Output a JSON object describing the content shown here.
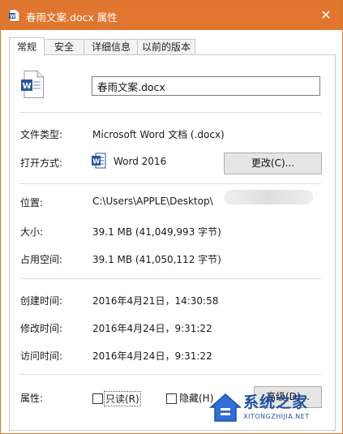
{
  "window": {
    "title": "春雨文案.docx 属性",
    "close_glyph": "✕",
    "accent_color": "#e0762f"
  },
  "tabs": [
    {
      "label": "常规",
      "active": true
    },
    {
      "label": "安全",
      "active": false
    },
    {
      "label": "详细信息",
      "active": false
    },
    {
      "label": "以前的版本",
      "active": false
    }
  ],
  "general": {
    "file_icon": "word-document-icon",
    "filename": "春雨文案.docx",
    "type_label": "文件类型:",
    "type_value": "Microsoft Word 文档 (.docx)",
    "opens_with_label": "打开方式:",
    "opens_with_icon": "word-icon",
    "opens_with_value": "Word 2016",
    "change_button": "更改(C)...",
    "location_label": "位置:",
    "location_value": "C:\\Users\\APPLE\\Desktop\\",
    "size_label": "大小:",
    "size_value": "39.1 MB (41,049,993 字节)",
    "size_on_disk_label": "占用空间:",
    "size_on_disk_value": "39.1 MB (41,050,112 字节)",
    "created_label": "创建时间:",
    "created_value": "2016年4月21日，14:30:58",
    "modified_label": "修改时间:",
    "modified_value": "2016年4月24日，9:31:22",
    "accessed_label": "访问时间:",
    "accessed_value": "2016年4月24日，9:31:22",
    "attributes_label": "属性:",
    "readonly_label": "只读(R)",
    "readonly_checked": false,
    "hidden_label": "隐藏(H)",
    "hidden_checked": false,
    "advanced_button": "高级(D)..."
  },
  "watermark": {
    "main": "系统之家",
    "sub": "XITONGZHIJIA.NET"
  }
}
